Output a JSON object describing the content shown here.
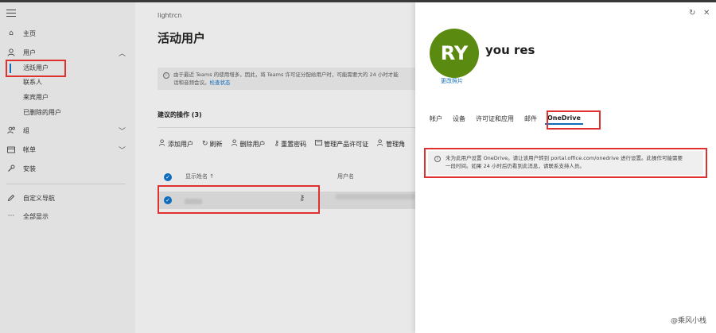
{
  "sidebar": {
    "items": [
      {
        "label": "主页",
        "icon": "home-icon"
      },
      {
        "label": "用户",
        "icon": "person-icon"
      },
      {
        "label": "组",
        "icon": "group-icon"
      },
      {
        "label": "帐单",
        "icon": "billing-icon"
      },
      {
        "label": "安装",
        "icon": "wrench-icon"
      },
      {
        "label": "自定义导航",
        "icon": "pencil-icon"
      },
      {
        "label": "全部显示",
        "icon": "more-icon"
      }
    ],
    "user_sub": [
      "活跃用户",
      "联系人",
      "来宾用户",
      "已删除的用户"
    ]
  },
  "main": {
    "org": "lightrcn",
    "title": "活动用户",
    "notice_line1": "由于最近 Teams 的使用增多，因此，将 Teams 许可证分配给用户时，可能需要大的 24 小时才能",
    "notice_line2": "话和音频会议。",
    "notice_link": "检查状态",
    "recommended": "建议的操作 (3)",
    "toolbar": [
      {
        "label": "添加用户",
        "icon": "add-user-icon"
      },
      {
        "label": "刷新",
        "icon": "refresh-icon"
      },
      {
        "label": "删除用户",
        "icon": "delete-user-icon"
      },
      {
        "label": "重置密码",
        "icon": "key-icon"
      },
      {
        "label": "管理产品许可证",
        "icon": "license-icon"
      },
      {
        "label": "管理角",
        "icon": "role-icon"
      }
    ],
    "col_display": "显示姓名 ↑",
    "col_username": "用户名"
  },
  "panel": {
    "initials": "RY",
    "name": "you res",
    "change_photo": "更改照片",
    "tabs": [
      "帐户",
      "设备",
      "许可证和应用",
      "邮件",
      "OneDrive"
    ],
    "onedrive_line1": "未为此用户设置 OneDrive。请让该用户转到 portal.office.com/onedrive 进行设置。此操作可能需要",
    "onedrive_line2": "一段时间。如果 24 小时后仍看到此消息，请联系支持人员。"
  },
  "watermark": "@乘风小栈",
  "colors": {
    "accent": "#0f6cbd",
    "avatar": "#5b8a11",
    "highlight": "#e03131"
  }
}
